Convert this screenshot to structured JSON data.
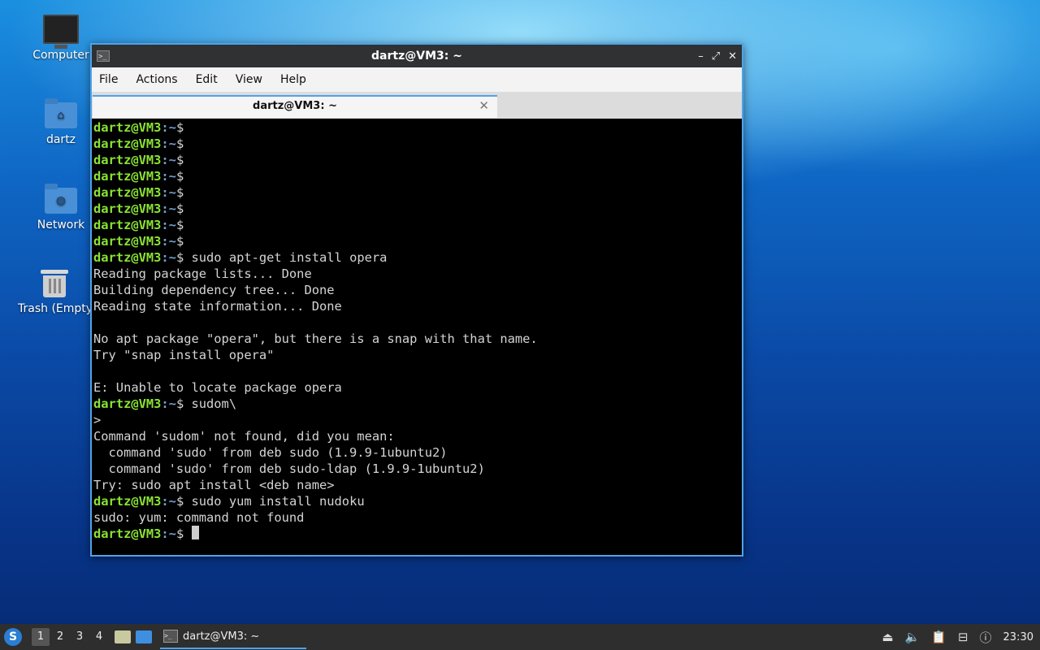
{
  "desktop": {
    "icons": [
      {
        "label": "Computer",
        "icon": "monitor-icon"
      },
      {
        "label": "dartz",
        "icon": "home-folder-icon"
      },
      {
        "label": "Network",
        "icon": "network-folder-icon"
      },
      {
        "label": "Trash (Empty)",
        "icon": "trash-icon"
      }
    ]
  },
  "window": {
    "title": "dartz@VM3: ~",
    "controls": {
      "minimize": "–",
      "maximize": "⤢",
      "close": "✕"
    },
    "menu": [
      "File",
      "Actions",
      "Edit",
      "View",
      "Help"
    ],
    "tab": {
      "label": "dartz@VM3: ~",
      "close": "✕"
    }
  },
  "terminal": {
    "prompt_user": "dartz@VM3",
    "prompt_path": ":~",
    "prompt_symbol": "$",
    "lines": [
      {
        "type": "prompt",
        "cmd": ""
      },
      {
        "type": "prompt",
        "cmd": ""
      },
      {
        "type": "prompt",
        "cmd": ""
      },
      {
        "type": "prompt",
        "cmd": ""
      },
      {
        "type": "prompt",
        "cmd": ""
      },
      {
        "type": "prompt",
        "cmd": ""
      },
      {
        "type": "prompt",
        "cmd": ""
      },
      {
        "type": "prompt",
        "cmd": ""
      },
      {
        "type": "prompt",
        "cmd": " sudo apt-get install opera"
      },
      {
        "type": "out",
        "text": "Reading package lists... Done"
      },
      {
        "type": "out",
        "text": "Building dependency tree... Done"
      },
      {
        "type": "out",
        "text": "Reading state information... Done"
      },
      {
        "type": "out",
        "text": ""
      },
      {
        "type": "out",
        "text": "No apt package \"opera\", but there is a snap with that name."
      },
      {
        "type": "out",
        "text": "Try \"snap install opera\""
      },
      {
        "type": "out",
        "text": ""
      },
      {
        "type": "out",
        "text": "E: Unable to locate package opera"
      },
      {
        "type": "prompt",
        "cmd": " sudom\\"
      },
      {
        "type": "out",
        "text": ">"
      },
      {
        "type": "out",
        "text": "Command 'sudom' not found, did you mean:"
      },
      {
        "type": "out",
        "text": "  command 'sudo' from deb sudo (1.9.9-1ubuntu2)"
      },
      {
        "type": "out",
        "text": "  command 'sudo' from deb sudo-ldap (1.9.9-1ubuntu2)"
      },
      {
        "type": "out",
        "text": "Try: sudo apt install <deb name>"
      },
      {
        "type": "prompt",
        "cmd": " sudo yum install nudoku"
      },
      {
        "type": "out",
        "text": "sudo: yum: command not found"
      },
      {
        "type": "cursor",
        "cmd": " "
      }
    ]
  },
  "taskbar": {
    "workspaces": [
      "1",
      "2",
      "3",
      "4"
    ],
    "active_workspace": "1",
    "task_label": "dartz@VM3: ~",
    "clock": "23:30"
  },
  "colors": {
    "accent": "#4fa3e8",
    "prompt_user": "#8ae234",
    "prompt_path": "#729fcf"
  }
}
